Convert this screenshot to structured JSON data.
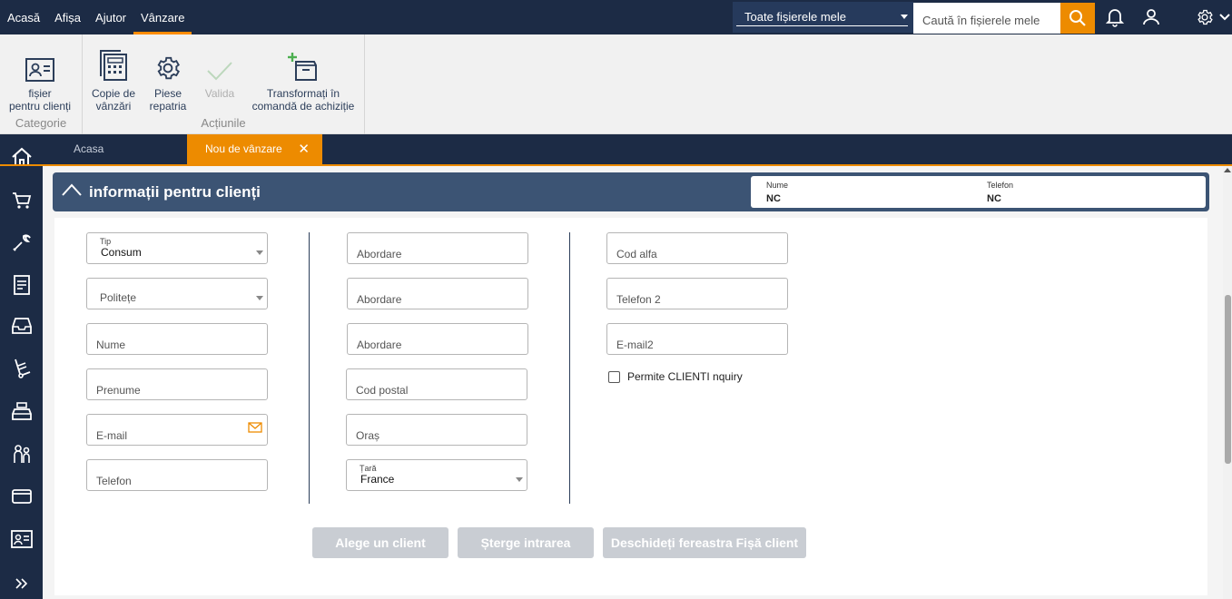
{
  "menu": {
    "items": [
      "Acasă",
      "Afișa",
      "Ajutor",
      "Vânzare"
    ],
    "active_index": 3
  },
  "header": {
    "file_select": "Toate fișierele mele",
    "search_placeholder": "Caută în fișierele mele",
    "accent_color": "#ed8b00",
    "bar_color": "#1c2b45"
  },
  "ribbon": {
    "groups": [
      {
        "label": "Categorie",
        "buttons": [
          {
            "label": "fișier\npentru clienți",
            "icon": "contact-card-icon"
          }
        ]
      },
      {
        "label": "Acțiunile",
        "buttons": [
          {
            "label": "Copie de\nvânzări",
            "icon": "copy-document-icon"
          },
          {
            "label": "Piese\nrepatria",
            "icon": "gear-icon"
          },
          {
            "label": "Valida",
            "icon": "checkmark-icon",
            "disabled": true
          },
          {
            "label": "Transformați în\ncomandă de achiziție",
            "icon": "add-box-icon"
          }
        ]
      }
    ]
  },
  "tabs": {
    "home": "Acasa",
    "active": "Nou de vânzare"
  },
  "panel": {
    "title": "informații pentru clienți",
    "summary": {
      "name_label": "Nume",
      "name_value": "NC",
      "phone_label": "Telefon",
      "phone_value": "NC"
    }
  },
  "form": {
    "col1": {
      "tip_label": "Tip",
      "tip_value": "Consum",
      "politete": "Politețe",
      "nume": "Nume",
      "prenume": "Prenume",
      "email": "E-mail",
      "telefon": "Telefon"
    },
    "col2": {
      "abordare1": "Abordare",
      "abordare2": "Abordare",
      "abordare3": "Abordare",
      "cod_postal": "Cod postal",
      "oras": "Oraș",
      "tara_label": "Țară",
      "tara_value": "France"
    },
    "col3": {
      "cod_alfa": "Cod alfa",
      "telefon2": "Telefon 2",
      "email2": "E-mail2",
      "permite": "Permite CLIENTI nquiry"
    },
    "buttons": {
      "alege": "Alege un client",
      "sterge": "Șterge intrarea",
      "deschide": "Deschideți fereastra Fișă client"
    }
  }
}
